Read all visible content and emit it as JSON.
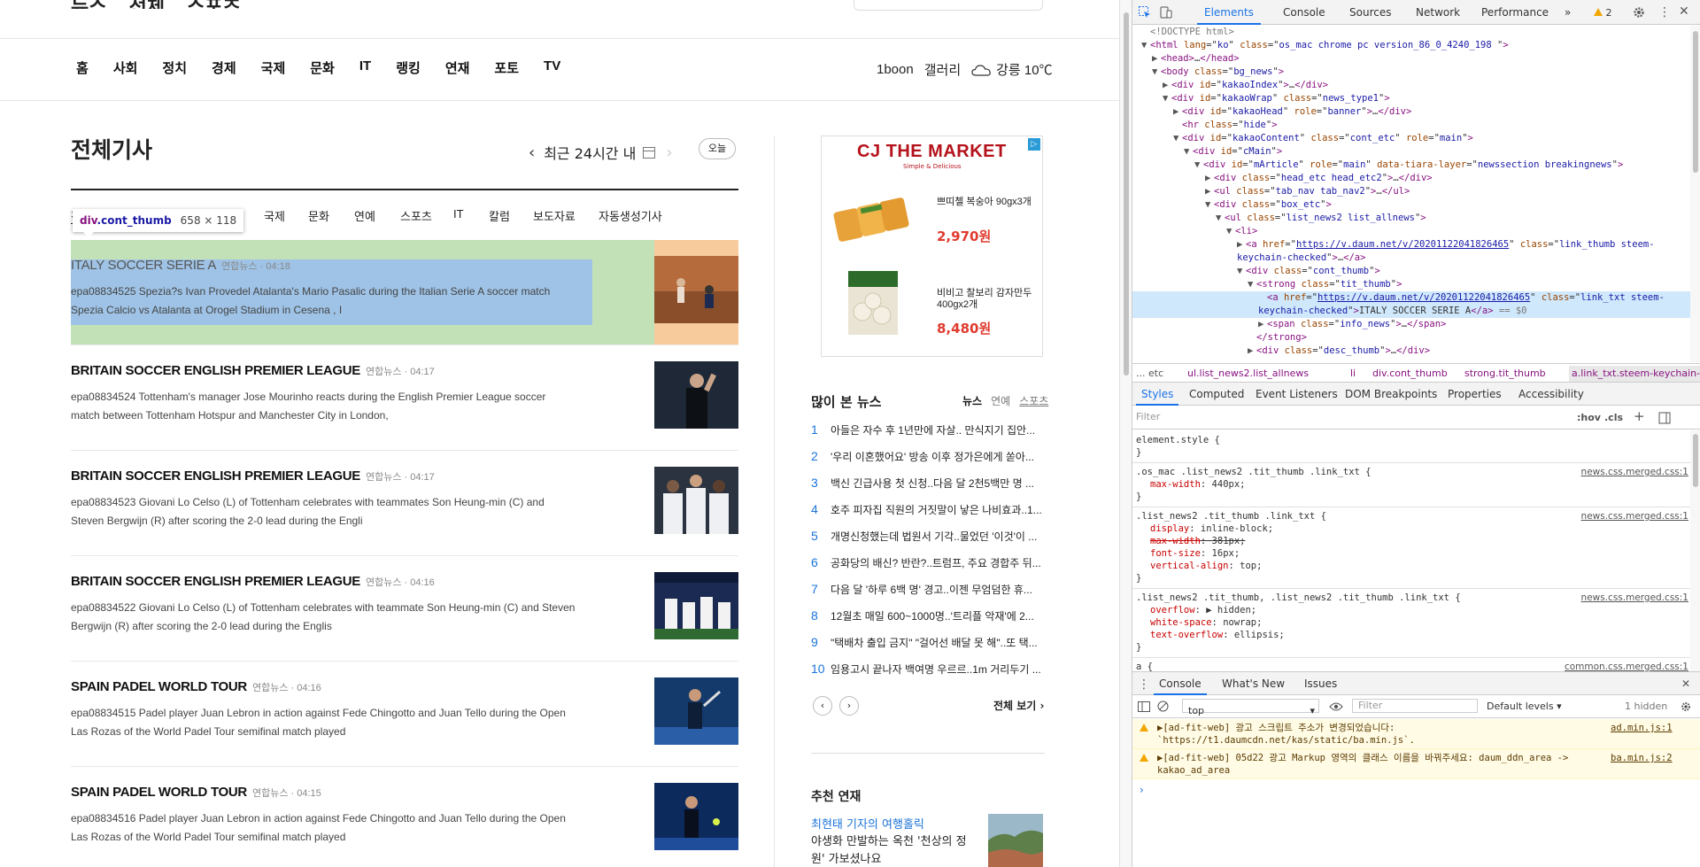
{
  "site": {
    "top_fragments": [
      "뉴스",
      "전체",
      "스포츠"
    ],
    "nav": [
      "홈",
      "사회",
      "정치",
      "경제",
      "국제",
      "문화",
      "IT",
      "랭킹",
      "연재",
      "포토",
      "TV"
    ],
    "nav_right": {
      "oneboon": "1boon",
      "gallery": "갤러리",
      "weather": "강릉 10℃"
    },
    "page_title": "전체기사",
    "date_label": "최근 24시간 내",
    "today_label": "오늘",
    "tabs": [
      "전체",
      "사회",
      "정치",
      "경제",
      "국제",
      "문화",
      "연예",
      "스포츠",
      "IT",
      "칼럼",
      "보도자료",
      "자동생성기사"
    ],
    "tooltip": {
      "tag": "div",
      "cls": ".cont_thumb",
      "size": "658 × 118"
    },
    "articles": [
      {
        "title": "ITALY SOCCER SERIE A",
        "info": "연합뉴스 · 04:18",
        "desc": "epa08834525 Spezia?s Ivan Provedel Atalanta's Mario Pasalic during the Italian Serie A soccer match Spezia Calcio vs Atalanta at Orogel Stadium in Cesena , I"
      },
      {
        "title": "BRITAIN SOCCER ENGLISH PREMIER LEAGUE",
        "info": "연합뉴스 · 04:17",
        "desc": "epa08834524 Tottenham's manager Jose Mourinho reacts during the English Premier League soccer match between Tottenham Hotspur and Manchester City in London,"
      },
      {
        "title": "BRITAIN SOCCER ENGLISH PREMIER LEAGUE",
        "info": "연합뉴스 · 04:17",
        "desc": "epa08834523 Giovani Lo Celso (L) of Tottenham celebrates with teammates Son Heung-min (C) and Steven Bergwijn (R) after scoring the 2-0 lead during the Engli"
      },
      {
        "title": "BRITAIN SOCCER ENGLISH PREMIER LEAGUE",
        "info": "연합뉴스 · 04:16",
        "desc": "epa08834522 Giovani Lo Celso (L) of Tottenham celebrates with teammate Son Heung-min (C) and Steven Bergwijn (R) after scoring the 2-0 lead during the Englis"
      },
      {
        "title": "SPAIN PADEL WORLD TOUR",
        "info": "연합뉴스 · 04:16",
        "desc": "epa08834515 Padel player Juan Lebron in action against Fede Chingotto and Juan Tello during the Open Las Rozas of the World Padel Tour semifinal match played"
      },
      {
        "title": "SPAIN PADEL WORLD TOUR",
        "info": "연합뉴스 · 04:15",
        "desc": "epa08834516 Padel player Juan Lebron in action against Fede Chingotto and Juan Tello during the Open Las Rozas of the World Padel Tour semifinal match played"
      }
    ],
    "ad": {
      "logo": "CJ THE MARKET",
      "logo_sub": "Simple & Delicious",
      "items": [
        {
          "name": "쁘띠첼 복숭아 90gx3개",
          "price": "2,970원"
        },
        {
          "name": "비비고 찰보리 감자만두 400gx2개",
          "price": "8,480원"
        }
      ]
    },
    "most_viewed": {
      "title": "많이 본 뉴스",
      "tabs": [
        "뉴스",
        "연예",
        "스포츠"
      ],
      "items": [
        "아들은 자수 후 1년만에 자살.. 만식지기 집안...",
        "'우리 이혼했어요' 방송 이후 정가은에게 쏟아...",
        "백신 긴급사용 첫 신청..다음 달 2천5백만 명 ...",
        "호주 피자집 직원의 거짓말이 낳은 나비효과..1...",
        "개명신청했는데 법원서 기각..물었던 '이것'이 ...",
        "공화당의 배신? 반란?..트럼프, 주요 경합주 뒤...",
        "다음 달 '하루 6백 명' 경고..이젠 무엄덤한 휴...",
        "12월초 매일 600~1000명..'트리플 악재'에 2...",
        "\"택배차 출입 금지\" \"걸어선 배달 못 해\"..또 택...",
        "임용고시 끝나자 백여명 우르르..1m 거리두기 ..."
      ],
      "see_all": "전체 보기"
    },
    "series": {
      "title": "추천 연재",
      "link": "최현태 기자의 여행홀릭",
      "desc": "야생화 만발하는 옥천 '천상의 정원' 가보셨나요"
    }
  },
  "devtools": {
    "tabs": [
      "Elements",
      "Console",
      "Sources",
      "Network",
      "Performance"
    ],
    "issues_count": "2",
    "dom": [
      {
        "d": 0,
        "t": "",
        "h": "<span class='gr'>&lt;!DOCTYPE html&gt;</span>"
      },
      {
        "d": 0,
        "t": "▼",
        "h": "<span class='tg'>&lt;html</span> <span class='at'>lang</span>=\"<span class='av'>ko</span>\" <span class='at'>class</span>=\"<span class='av'>os_mac chrome pc version_86_0_4240_198 </span>\"<span class='tg'>&gt;</span>"
      },
      {
        "d": 1,
        "t": "▶",
        "h": "<span class='tg'>&lt;head&gt;</span>…<span class='tg'>&lt;/head&gt;</span>"
      },
      {
        "d": 1,
        "t": "▼",
        "h": "<span class='tg'>&lt;body</span> <span class='at'>class</span>=\"<span class='av'>bg_news</span>\"<span class='tg'>&gt;</span>"
      },
      {
        "d": 2,
        "t": "▶",
        "h": "<span class='tg'>&lt;div</span> <span class='at'>id</span>=\"<span class='av'>kakaoIndex</span>\"<span class='tg'>&gt;</span>…<span class='tg'>&lt;/div&gt;</span>"
      },
      {
        "d": 2,
        "t": "▼",
        "h": "<span class='tg'>&lt;div</span> <span class='at'>id</span>=\"<span class='av'>kakaoWrap</span>\" <span class='at'>class</span>=\"<span class='av'>news_type1</span>\"<span class='tg'>&gt;</span>"
      },
      {
        "d": 3,
        "t": "▶",
        "h": "<span class='tg'>&lt;div</span> <span class='at'>id</span>=\"<span class='av'>kakaoHead</span>\" <span class='at'>role</span>=\"<span class='av'>banner</span>\"<span class='tg'>&gt;</span>…<span class='tg'>&lt;/div&gt;</span>"
      },
      {
        "d": 3,
        "t": "",
        "h": "<span class='tg'>&lt;hr</span> <span class='at'>class</span>=\"<span class='av'>hide</span>\"<span class='tg'>&gt;</span>"
      },
      {
        "d": 3,
        "t": "▼",
        "h": "<span class='tg'>&lt;div</span> <span class='at'>id</span>=\"<span class='av'>kakaoContent</span>\" <span class='at'>class</span>=\"<span class='av'>cont_etc</span>\" <span class='at'>role</span>=\"<span class='av'>main</span>\"<span class='tg'>&gt;</span>"
      },
      {
        "d": 4,
        "t": "▼",
        "h": "<span class='tg'>&lt;div</span> <span class='at'>id</span>=\"<span class='av'>cMain</span>\"<span class='tg'>&gt;</span>"
      },
      {
        "d": 5,
        "t": "▼",
        "h": "<span class='tg'>&lt;div</span> <span class='at'>id</span>=\"<span class='av'>mArticle</span>\" <span class='at'>role</span>=\"<span class='av'>main</span>\" <span class='at'>data-tiara-layer</span>=\"<span class='av'>newssection breakingnews</span>\"<span class='tg'>&gt;</span>"
      },
      {
        "d": 6,
        "t": "▶",
        "h": "<span class='tg'>&lt;div</span> <span class='at'>class</span>=\"<span class='av'>head_etc head_etc2</span>\"<span class='tg'>&gt;</span>…<span class='tg'>&lt;/div&gt;</span>"
      },
      {
        "d": 6,
        "t": "▶",
        "h": "<span class='tg'>&lt;ul</span> <span class='at'>class</span>=\"<span class='av'>tab_nav tab_nav2</span>\"<span class='tg'>&gt;</span>…<span class='tg'>&lt;/ul&gt;</span>"
      },
      {
        "d": 6,
        "t": "▼",
        "h": "<span class='tg'>&lt;div</span> <span class='at'>class</span>=\"<span class='av'>box_etc</span>\"<span class='tg'>&gt;</span>"
      },
      {
        "d": 7,
        "t": "▼",
        "h": "<span class='tg'>&lt;ul</span> <span class='at'>class</span>=\"<span class='av'>list_news2 list_allnews</span>\"<span class='tg'>&gt;</span>"
      },
      {
        "d": 8,
        "t": "▼",
        "h": "<span class='tg'>&lt;li&gt;</span>"
      },
      {
        "d": 9,
        "t": "▶",
        "wrap": true,
        "h": "<span class='tg'>&lt;a</span> <span class='at'>href</span>=\"<span class='ln'>https://v.daum.net/v/20201122041826465</span>\" <span class='at'>class</span>=\"<span class='av'>link_thumb steem-keychain-checked</span>\"<span class='tg'>&gt;</span>…<span class='tg'>&lt;/a&gt;</span>"
      },
      {
        "d": 9,
        "t": "▼",
        "h": "<span class='tg'>&lt;div</span> <span class='at'>class</span>=\"<span class='av'>cont_thumb</span>\"<span class='tg'>&gt;</span>"
      },
      {
        "d": 10,
        "t": "▼",
        "h": "<span class='tg'>&lt;strong</span> <span class='at'>class</span>=\"<span class='av'>tit_thumb</span>\"<span class='tg'>&gt;</span>"
      },
      {
        "d": 11,
        "t": "",
        "sel": true,
        "wrap": true,
        "h": "<span class='tg'>&lt;a</span> <span class='at'>href</span>=\"<span class='ln'>https://v.daum.net/v/20201122041826465</span>\" <span class='at'>class</span>=\"<span class='av'>link_txt steem-keychain-checked</span>\"<span class='tg'>&gt;</span>ITALY SOCCER SERIE A<span class='tg'>&lt;/a&gt;</span> <span class='gr'>== $0</span>"
      },
      {
        "d": 11,
        "t": "▶",
        "h": "<span class='tg'>&lt;span</span> <span class='at'>class</span>=\"<span class='av'>info_news</span>\"<span class='tg'>&gt;</span>…<span class='tg'>&lt;/span&gt;</span>"
      },
      {
        "d": 10,
        "t": "",
        "h": "<span class='tg'>&lt;/strong&gt;</span>"
      },
      {
        "d": 10,
        "t": "▶",
        "h": "<span class='tg'>&lt;div</span> <span class='at'>class</span>=\"<span class='av'>desc_thumb</span>\"<span class='tg'>&gt;</span>…<span class='tg'>&lt;/div&gt;</span>"
      }
    ],
    "breadcrumbs": [
      {
        "t": "... etc",
        "c": "gr"
      },
      {
        "t": "ul.list_news2.list_allnews",
        "c": ""
      },
      {
        "t": "li",
        "c": ""
      },
      {
        "t": "div.cont_thumb",
        "c": ""
      },
      {
        "t": "strong.tit_thumb",
        "c": ""
      },
      {
        "t": "a.link_txt.steem-keychain-checked",
        "c": "sel"
      },
      {
        "t": "...",
        "c": "gr"
      }
    ],
    "style_tabs": [
      "Styles",
      "Computed",
      "Event Listeners",
      "DOM Breakpoints",
      "Properties",
      "Accessibility"
    ],
    "filter_placeholder": "Filter",
    "hov": ":hov",
    "cls": ".cls",
    "rules": [
      {
        "selector": "element.style {",
        "source": "",
        "props": []
      },
      {
        "selector": ".os_mac .list_news2 .tit_thumb .link_txt {",
        "source": "news.css.merged.css:1",
        "props": [
          {
            "p": "max-width",
            "v": "440px;",
            "s": false
          }
        ]
      },
      {
        "selector": ".list_news2 .tit_thumb .link_txt {",
        "source": "news.css.merged.css:1",
        "props": [
          {
            "p": "display",
            "v": "inline-block;",
            "s": false
          },
          {
            "p": "max-width",
            "v": "381px;",
            "s": true
          },
          {
            "p": "font-size",
            "v": "16px;",
            "s": false
          },
          {
            "p": "vertical-align",
            "v": "top;",
            "s": false
          }
        ]
      },
      {
        "selector": ".list_news2 .tit_thumb, .list_news2 .tit_thumb .link_txt {",
        "source": "news.css.merged.css:1",
        "props": [
          {
            "p": "overflow",
            "v": "▶ hidden;",
            "s": false
          },
          {
            "p": "white-space",
            "v": "nowrap;",
            "s": false
          },
          {
            "p": "text-overflow",
            "v": "ellipsis;",
            "s": false
          }
        ]
      },
      {
        "selector": "a {",
        "source": "common.css.merged.css:1",
        "props": []
      }
    ],
    "drawer_tabs": [
      "Console",
      "What's New",
      "Issues"
    ],
    "console": {
      "context": "top",
      "filter": "Filter",
      "levels": "Default levels ▾",
      "hidden": "1 hidden",
      "messages": [
        {
          "text": "▶[ad-fit-web] 광고 스크립트 주소가 변경되었습니다: `https://t1.daumcdn.net/kas/static/ba.min.js`.",
          "source": "ad.min.js:1"
        },
        {
          "text": "▶[ad-fit-web] 05d22 광고 Markup 영역의 클래스 이름을 바꿔주세요: daum_ddn_area -> kakao_ad_area",
          "source": "ba.min.js:2"
        }
      ]
    }
  },
  "colors": {
    "accent": "#1a73e8",
    "green_overlay": "#c3e1b6",
    "orange_overlay": "#f8cb9c",
    "blue_overlay": "#9fc3e6",
    "price": "#e03a2e"
  }
}
